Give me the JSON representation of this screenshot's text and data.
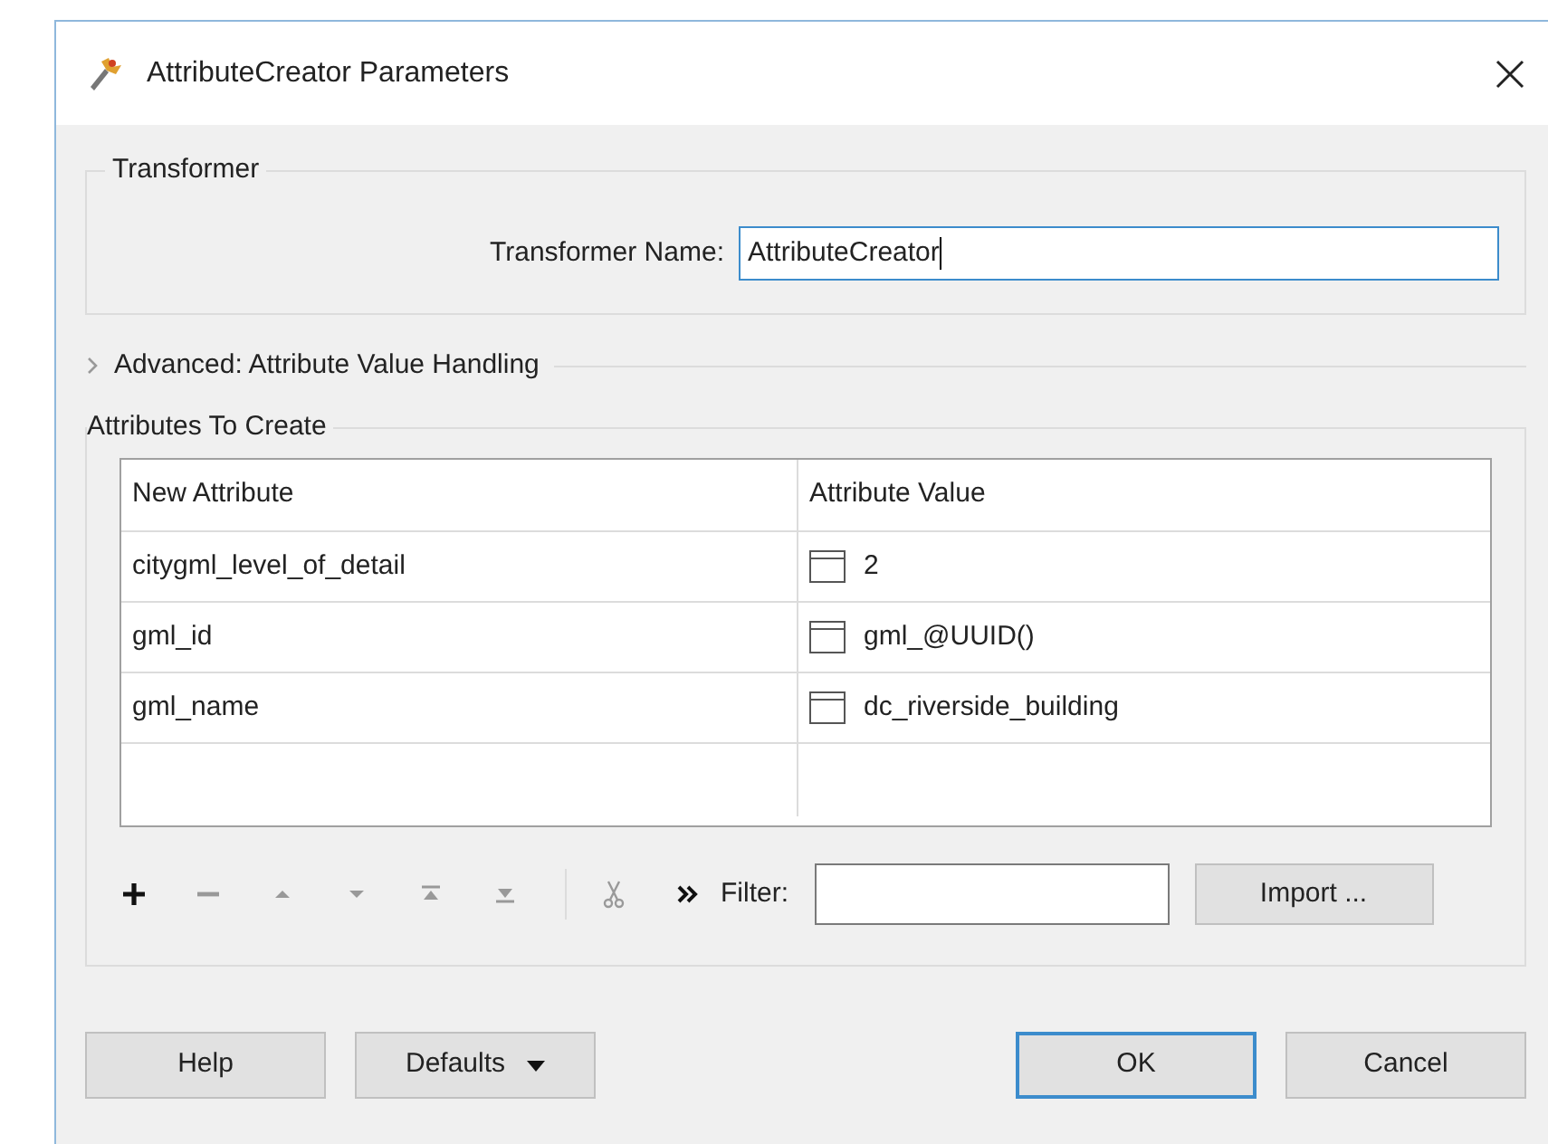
{
  "window": {
    "title": "AttributeCreator Parameters"
  },
  "transformer": {
    "group_title": "Transformer",
    "name_label": "Transformer Name:",
    "name_value": "AttributeCreator"
  },
  "advanced": {
    "label": "Advanced: Attribute Value Handling",
    "expanded": false
  },
  "attributes": {
    "group_title": "Attributes To Create",
    "columns": [
      "New Attribute",
      "Attribute Value"
    ],
    "rows": [
      {
        "name": "citygml_level_of_detail",
        "value": "2"
      },
      {
        "name": "gml_id",
        "value": "gml_@UUID()"
      },
      {
        "name": "gml_name",
        "value": "dc_riverside_building"
      }
    ],
    "toolbar": [
      {
        "kind": "add",
        "disabled": false
      },
      {
        "kind": "remove",
        "disabled": true
      },
      {
        "kind": "up",
        "disabled": true
      },
      {
        "kind": "down",
        "disabled": true
      },
      {
        "kind": "top",
        "disabled": true
      },
      {
        "kind": "bottom",
        "disabled": true
      },
      {
        "kind": "cut",
        "disabled": true
      },
      {
        "kind": "more",
        "disabled": false
      }
    ],
    "filter_label": "Filter:",
    "import_button": "Import ..."
  },
  "buttons": [
    {
      "label": "Help",
      "kind": "plain",
      "default": false
    },
    {
      "label": "Defaults",
      "kind": "menu",
      "default": false
    },
    {
      "label": "OK",
      "kind": "plain",
      "default": true
    },
    {
      "label": "Cancel",
      "kind": "plain",
      "default": false
    }
  ]
}
